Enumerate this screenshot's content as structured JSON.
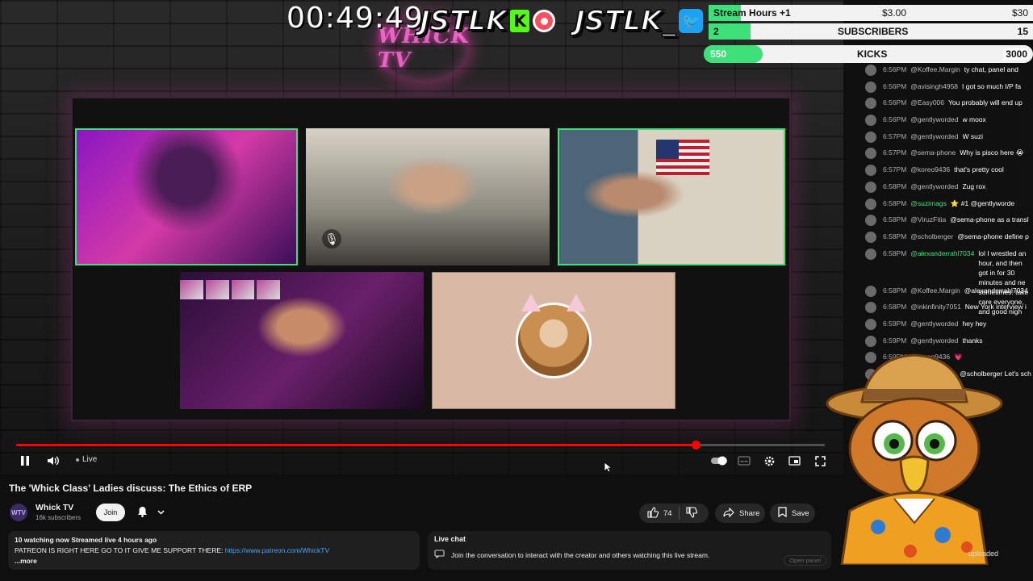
{
  "overlay": {
    "timer": "00:49:49",
    "brand_kick": "JSTLK",
    "brand_kick_badge": "K",
    "brand_twitter": "JSTLK_",
    "neon_logo": "WHICK TV"
  },
  "goals": {
    "stream_hours": {
      "label": "Stream Hours +1",
      "mid": "$3.00",
      "end": "$30",
      "progress": 0.1
    },
    "subscribers": {
      "left": "2",
      "label": "SUBSCRIBERS",
      "end": "15",
      "progress": 0.13
    },
    "kicks": {
      "left": "550",
      "label": "KICKS",
      "end": "3000",
      "progress": 0.18
    }
  },
  "chat": {
    "messages": [
      {
        "time": "6:56PM",
        "user": "@Koffee.Margin",
        "text": "ty chat, panel and"
      },
      {
        "time": "6:56PM",
        "user": "@avisingh4958",
        "text": "I got so much I/P fa"
      },
      {
        "time": "6:56PM",
        "user": "@Easy006",
        "text": "You probably will end up"
      },
      {
        "time": "6:56PM",
        "user": "@gentlyworded",
        "text": "w moox"
      },
      {
        "time": "6:57PM",
        "user": "@gentlyworded",
        "text": "W suzi"
      },
      {
        "time": "6:57PM",
        "user": "@sema-phone",
        "text": "Why is pisco here 😭"
      },
      {
        "time": "6:57PM",
        "user": "@koreo9436",
        "text": "that's pretty cool"
      },
      {
        "time": "6:58PM",
        "user": "@gentlyworded",
        "text": "Zug rox"
      },
      {
        "time": "6:58PM",
        "user": "@suzimags",
        "text": "⭐ #1 @gentlyworde",
        "green": true
      },
      {
        "time": "6:58PM",
        "user": "@ViruzFitia",
        "text": "@sema-phone as a transl"
      },
      {
        "time": "6:58PM",
        "user": "@scholberger",
        "text": "@sema-phone define p"
      },
      {
        "time": "6:58PM",
        "user": "@alexanderrahl7034",
        "text": "lol I wrestled an hour, and then got in for 30 minutes and ne sometimes. take care everyone, and good nigh",
        "green": true,
        "tall": true
      },
      {
        "time": "6:58PM",
        "user": "@Koffee.Margin",
        "text": "@alexanderrahl7034"
      },
      {
        "time": "6:58PM",
        "user": "@inkinfinity7051",
        "text": "New York interview i"
      },
      {
        "time": "6:59PM",
        "user": "@gentlyworded",
        "text": "hey hey"
      },
      {
        "time": "6:59PM",
        "user": "@gentlyworded",
        "text": "thanks"
      },
      {
        "time": "6:59PM",
        "user": "@koreo9436",
        "text": "💗"
      },
      {
        "time": "6:59PM",
        "user": "@sema-phone",
        "text": "@scholberger Let's sch"
      }
    ]
  },
  "player": {
    "live_label": "Live",
    "progress": 0.84
  },
  "video": {
    "title": "The 'Whick Class' Ladies discuss: The Ethics of ERP",
    "channel_name": "Whick TV",
    "channel_subs": "16k subscribers",
    "channel_avatar": "WTV",
    "join_label": "Join",
    "likes": "74",
    "share_label": "Share",
    "save_label": "Save"
  },
  "description": {
    "meta": "10 watching now  Streamed live 4 hours ago",
    "text": "PATREON IS RIGHT HERE GO TO IT GIVE ME SUPPORT THERE: ",
    "link": "https://www.patreon.com/WhickTV",
    "more": "...more"
  },
  "live_chat": {
    "title": "Live chat",
    "prompt": "Join the conversation to interact with the creator and others watching this live stream.",
    "open_panel": "Open panel"
  },
  "side": {
    "uploaded": "uploaded"
  },
  "icons": {
    "pause": "pause-icon",
    "volume": "volume-icon",
    "autoplay": "autoplay-toggle-icon",
    "captions": "captions-icon",
    "settings": "gear-icon",
    "miniplayer": "miniplayer-icon",
    "fullscreen": "fullscreen-icon",
    "bell": "bell-icon",
    "like": "thumbs-up-icon",
    "dislike": "thumbs-down-icon",
    "share": "share-icon",
    "save": "save-icon"
  },
  "colors": {
    "accent_red": "#ff0000",
    "kick_green": "#53fc18",
    "goal_green": "#3ee07a",
    "link_blue": "#3ea6ff"
  }
}
